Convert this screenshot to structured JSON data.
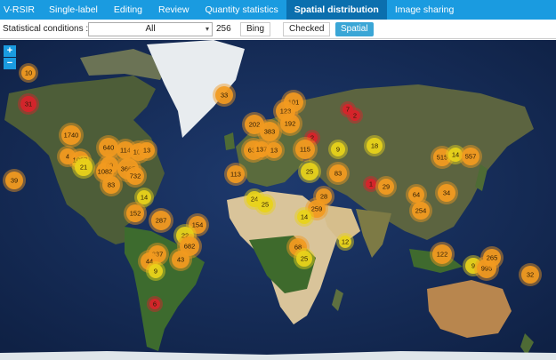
{
  "nav": {
    "brand": "V-RSIR",
    "items": [
      {
        "label": "Single-label"
      },
      {
        "label": "Editing"
      },
      {
        "label": "Review"
      },
      {
        "label": "Quantity statistics"
      },
      {
        "label": "Spatial distribution",
        "active": true
      },
      {
        "label": "Image sharing"
      }
    ]
  },
  "filters": {
    "label": "Statistical conditions :",
    "select_value": "All",
    "count": "256",
    "source": "Bing",
    "status": "Checked",
    "mode_button": "Spatial"
  },
  "zoom": {
    "in": "+",
    "out": "−"
  },
  "colors": {
    "nav_bg": "#1a9be0",
    "nav_active": "#0b6fae",
    "cluster_orange": "#f29a1f",
    "cluster_yellow": "#e8d21a",
    "cluster_red": "#d8232a"
  },
  "clusters": [
    {
      "label": "10",
      "color": "orange"
    },
    {
      "label": "31",
      "color": "red"
    },
    {
      "label": "1740",
      "color": "orange"
    },
    {
      "label": "640",
      "color": "orange"
    },
    {
      "label": "114",
      "color": "orange"
    },
    {
      "label": "102",
      "color": "orange"
    },
    {
      "label": "13",
      "color": "orange"
    },
    {
      "label": "4",
      "color": "orange"
    },
    {
      "label": "1007",
      "color": "orange"
    },
    {
      "label": "21",
      "color": "yellow"
    },
    {
      "label": "89",
      "color": "orange"
    },
    {
      "label": "1082",
      "color": "orange"
    },
    {
      "label": "3665",
      "color": "orange"
    },
    {
      "label": "732",
      "color": "orange"
    },
    {
      "label": "83",
      "color": "orange"
    },
    {
      "label": "39",
      "color": "orange"
    },
    {
      "label": "14",
      "color": "yellow"
    },
    {
      "label": "152",
      "color": "orange"
    },
    {
      "label": "287",
      "color": "orange"
    },
    {
      "label": "154",
      "color": "orange"
    },
    {
      "label": "22",
      "color": "yellow"
    },
    {
      "label": "682",
      "color": "orange"
    },
    {
      "label": "337",
      "color": "orange"
    },
    {
      "label": "44",
      "color": "orange"
    },
    {
      "label": "43",
      "color": "orange"
    },
    {
      "label": "9",
      "color": "yellow"
    },
    {
      "label": "6",
      "color": "red"
    },
    {
      "label": "33",
      "color": "orange"
    },
    {
      "label": "101",
      "color": "orange"
    },
    {
      "label": "123",
      "color": "orange"
    },
    {
      "label": "202",
      "color": "orange"
    },
    {
      "label": "383",
      "color": "orange"
    },
    {
      "label": "192",
      "color": "orange"
    },
    {
      "label": "2",
      "color": "red"
    },
    {
      "label": "7",
      "color": "red"
    },
    {
      "label": "2",
      "color": "red"
    },
    {
      "label": "634",
      "color": "orange"
    },
    {
      "label": "137",
      "color": "orange"
    },
    {
      "label": "13",
      "color": "orange"
    },
    {
      "label": "115",
      "color": "orange"
    },
    {
      "label": "9",
      "color": "yellow"
    },
    {
      "label": "18",
      "color": "yellow"
    },
    {
      "label": "113",
      "color": "orange"
    },
    {
      "label": "25",
      "color": "yellow"
    },
    {
      "label": "83",
      "color": "orange"
    },
    {
      "label": "1",
      "color": "red"
    },
    {
      "label": "29",
      "color": "orange"
    },
    {
      "label": "515",
      "color": "orange"
    },
    {
      "label": "14",
      "color": "yellow"
    },
    {
      "label": "557",
      "color": "orange"
    },
    {
      "label": "64",
      "color": "orange"
    },
    {
      "label": "34",
      "color": "orange"
    },
    {
      "label": "254",
      "color": "orange"
    },
    {
      "label": "24",
      "color": "yellow"
    },
    {
      "label": "25",
      "color": "yellow"
    },
    {
      "label": "28",
      "color": "orange"
    },
    {
      "label": "259",
      "color": "orange"
    },
    {
      "label": "14",
      "color": "yellow"
    },
    {
      "label": "68",
      "color": "orange"
    },
    {
      "label": "25",
      "color": "yellow"
    },
    {
      "label": "12",
      "color": "yellow"
    },
    {
      "label": "122",
      "color": "orange"
    },
    {
      "label": "9",
      "color": "yellow"
    },
    {
      "label": "995",
      "color": "orange"
    },
    {
      "label": "265",
      "color": "orange"
    },
    {
      "label": "32",
      "color": "orange"
    }
  ]
}
